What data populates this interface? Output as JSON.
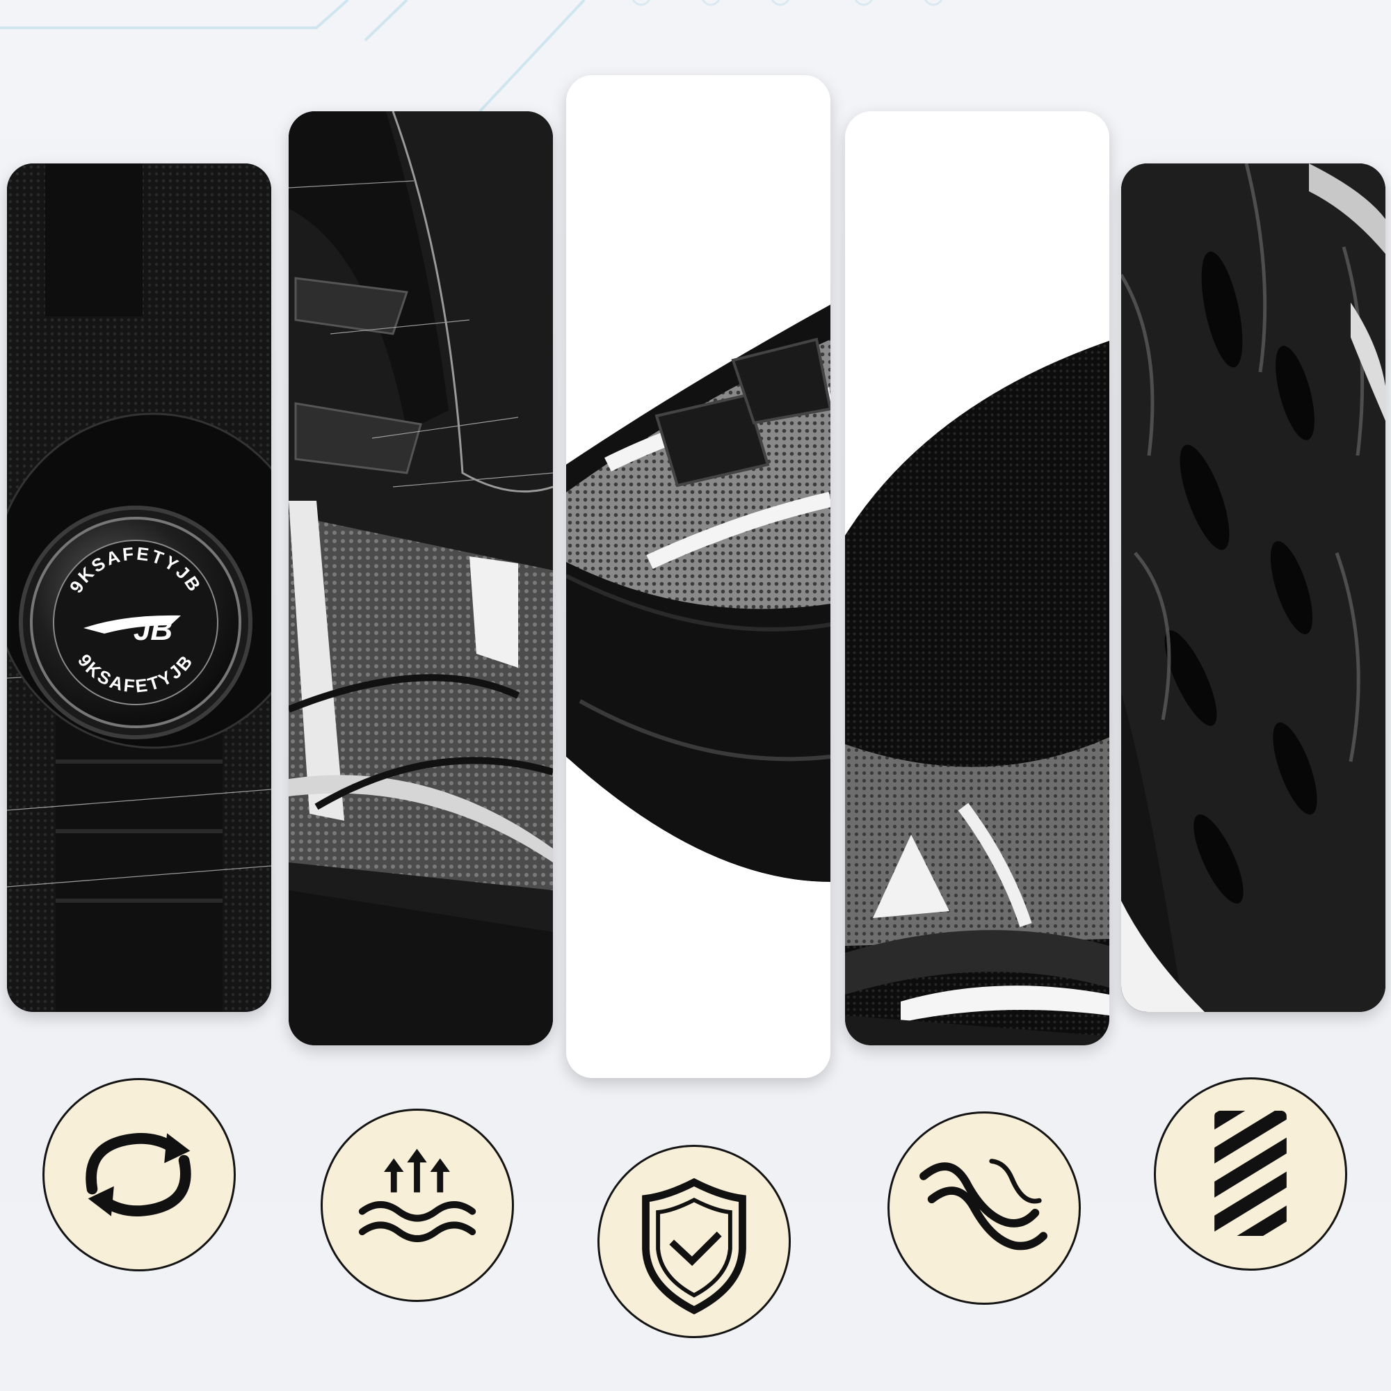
{
  "knob": {
    "brand_top": "9KSAFETYJB",
    "brand_bottom": "9KSAFETYJB",
    "logo_mark": "JB"
  },
  "panels": [
    {
      "subject": "rotary-lace-knob"
    },
    {
      "subject": "mesh-side-detail"
    },
    {
      "subject": "toe-cap-detail"
    },
    {
      "subject": "collar-mesh-detail"
    },
    {
      "subject": "sole-tread-detail"
    }
  ],
  "feature_icons": [
    {
      "icon": "rotate-arrows-icon"
    },
    {
      "icon": "breathable-waves-icon"
    },
    {
      "icon": "shield-check-icon"
    },
    {
      "icon": "flexible-waves-icon"
    },
    {
      "icon": "anti-slip-stripes-icon"
    }
  ],
  "colors": {
    "background": "#f1f2f5",
    "badge_fill": "#f8efd9",
    "icon_ink": "#111111",
    "accent_lines": "#bfe3f2"
  }
}
